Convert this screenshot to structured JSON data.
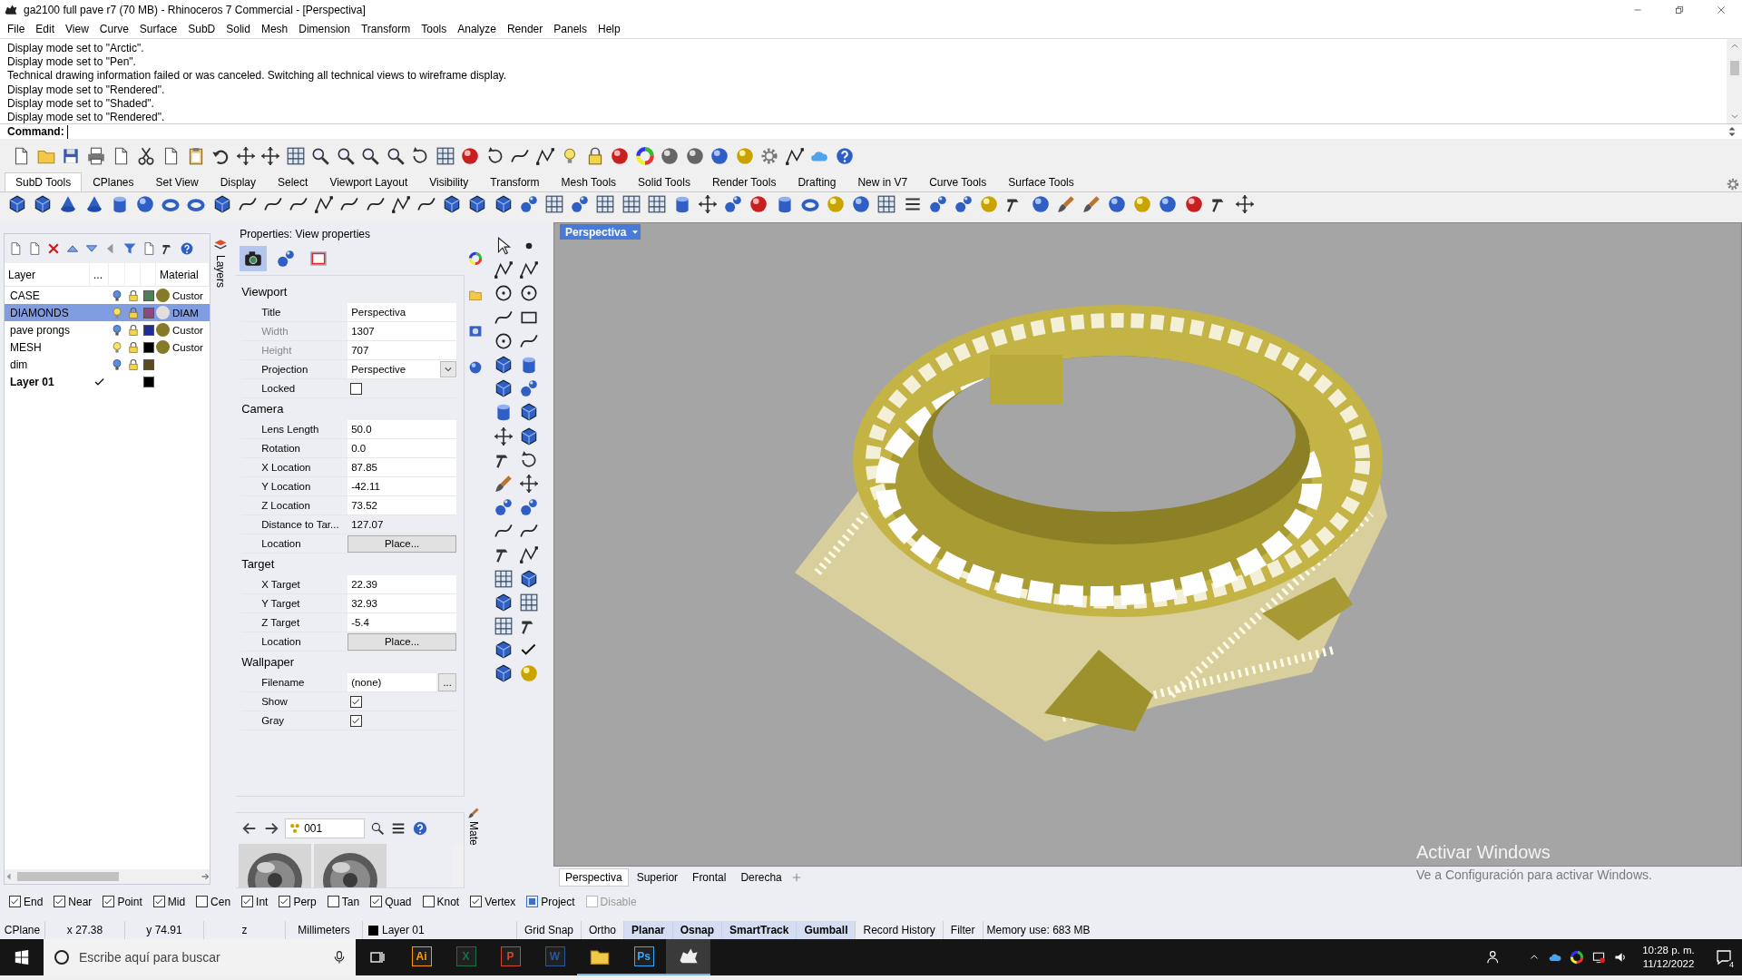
{
  "window": {
    "title": "ga2100 full pave r7 (70 MB) - Rhinoceros 7 Commercial - [Perspectiva]"
  },
  "menu": [
    "File",
    "Edit",
    "View",
    "Curve",
    "Surface",
    "SubD",
    "Solid",
    "Mesh",
    "Dimension",
    "Transform",
    "Tools",
    "Analyze",
    "Render",
    "Panels",
    "Help"
  ],
  "command_history": [
    "Display mode set to \"Arctic\".",
    "Display mode set to \"Pen\".",
    "Technical drawing information failed or was canceled. Switching all technical views to wireframe display.",
    "Display mode set to \"Rendered\".",
    "Display mode set to \"Shaded\".",
    "Display mode set to \"Rendered\"."
  ],
  "command": {
    "label": "Command:"
  },
  "toolbar_tabs": [
    {
      "label": "SubD Tools",
      "selected": true
    },
    {
      "label": "CPlanes",
      "selected": false
    },
    {
      "label": "Set View",
      "selected": false
    },
    {
      "label": "Display",
      "selected": false
    },
    {
      "label": "Select",
      "selected": false
    },
    {
      "label": "Viewport Layout",
      "selected": false
    },
    {
      "label": "Visibility",
      "selected": false
    },
    {
      "label": "Transform",
      "selected": false
    },
    {
      "label": "Mesh Tools",
      "selected": false
    },
    {
      "label": "Solid Tools",
      "selected": false
    },
    {
      "label": "Render Tools",
      "selected": false
    },
    {
      "label": "Drafting",
      "selected": false
    },
    {
      "label": "New in V7",
      "selected": false
    },
    {
      "label": "Curve Tools",
      "selected": false
    },
    {
      "label": "Surface Tools",
      "selected": false
    }
  ],
  "layers": {
    "tab_label": "Layers",
    "columns": [
      "Layer",
      "...",
      "Material"
    ],
    "rows": [
      {
        "name": "CASE",
        "selected": false,
        "current": false,
        "bulb_lit": false,
        "color": "#4f7f57",
        "material": {
          "name": "Custor",
          "color": "#857a28"
        }
      },
      {
        "name": "DIAMONDS",
        "selected": true,
        "current": false,
        "bulb_lit": true,
        "color": "#8a4a80",
        "material": {
          "name": "DIAM",
          "color": "#e2dede"
        }
      },
      {
        "name": "pave prongs",
        "selected": false,
        "current": false,
        "bulb_lit": false,
        "color": "#1c2a9a",
        "material": {
          "name": "Custor",
          "color": "#857a28"
        }
      },
      {
        "name": "MESH",
        "selected": false,
        "current": false,
        "bulb_lit": true,
        "color": "#000000",
        "material": {
          "name": "Custor",
          "color": "#857a28"
        }
      },
      {
        "name": "dim",
        "selected": false,
        "current": false,
        "bulb_lit": false,
        "color": "#5a4a1e"
      },
      {
        "name": "Layer 01",
        "selected": false,
        "current": true,
        "color": "#000000"
      }
    ]
  },
  "properties": {
    "title": "Properties: View properties",
    "pages": [
      {
        "kind": "camera",
        "selected": true
      },
      {
        "kind": "spheres",
        "selected": false
      },
      {
        "kind": "frame",
        "selected": false
      }
    ],
    "sections": [
      {
        "title": "Viewport",
        "rows": [
          {
            "kind": "field",
            "label": "Title",
            "value": "Perspectiva",
            "disabled": false
          },
          {
            "kind": "field",
            "label": "Width",
            "value": "1307",
            "disabled": true
          },
          {
            "kind": "field",
            "label": "Height",
            "value": "707",
            "disabled": true
          },
          {
            "kind": "dropdown",
            "label": "Projection",
            "value": "Perspective",
            "disabled": false
          },
          {
            "kind": "checkbox",
            "label": "Locked",
            "checked": false,
            "disabled": false
          }
        ]
      },
      {
        "title": "Camera",
        "rows": [
          {
            "kind": "field",
            "label": "Lens Length",
            "value": "50.0",
            "disabled": false
          },
          {
            "kind": "field",
            "label": "Rotation",
            "value": "0.0",
            "disabled": false
          },
          {
            "kind": "field",
            "label": "X Location",
            "value": "87.85",
            "disabled": false
          },
          {
            "kind": "field",
            "label": "Y Location",
            "value": "-42.11",
            "disabled": false
          },
          {
            "kind": "field",
            "label": "Z Location",
            "value": "73.52",
            "disabled": false
          },
          {
            "kind": "value",
            "label": "Distance to Tar...",
            "value": "127.07",
            "disabled": false
          },
          {
            "kind": "button",
            "label": "Location",
            "value": "Place...",
            "disabled": false
          }
        ]
      },
      {
        "title": "Target",
        "rows": [
          {
            "kind": "field",
            "label": "X Target",
            "value": "22.39",
            "disabled": false
          },
          {
            "kind": "field",
            "label": "Y Target",
            "value": "32.93",
            "disabled": false
          },
          {
            "kind": "field",
            "label": "Z Target",
            "value": "-5.4",
            "disabled": false
          },
          {
            "kind": "button",
            "label": "Location",
            "value": "Place...",
            "disabled": false
          }
        ]
      },
      {
        "title": "Wallpaper",
        "rows": [
          {
            "kind": "browse",
            "label": "Filename",
            "value": "(none)",
            "button": "...",
            "disabled": false
          },
          {
            "kind": "checkbox",
            "label": "Show",
            "checked": true,
            "disabled": false
          },
          {
            "kind": "checkbox",
            "label": "Gray",
            "checked": true,
            "disabled": false
          }
        ]
      }
    ]
  },
  "materials": {
    "tab_label": "Mate",
    "search": "001"
  },
  "viewport": {
    "title": "Perspectiva",
    "tabs": [
      {
        "label": "Perspectiva",
        "selected": true
      },
      {
        "label": "Superior",
        "selected": false
      },
      {
        "label": "Frontal",
        "selected": false
      },
      {
        "label": "Derecha",
        "selected": false
      }
    ],
    "activation_notice": {
      "title": "Activar Windows",
      "text": "Ve a Configuración para activar Windows."
    }
  },
  "osnaps": [
    {
      "kind": "tick",
      "label": "End",
      "checked": true,
      "disabled": false
    },
    {
      "kind": "tick",
      "label": "Near",
      "checked": true,
      "disabled": false
    },
    {
      "kind": "tick",
      "label": "Point",
      "checked": true,
      "disabled": false
    },
    {
      "kind": "tick",
      "label": "Mid",
      "checked": true,
      "disabled": false
    },
    {
      "kind": "tick",
      "label": "Cen",
      "checked": false,
      "disabled": false
    },
    {
      "kind": "tick",
      "label": "Int",
      "checked": true,
      "disabled": false
    },
    {
      "kind": "tick",
      "label": "Perp",
      "checked": true,
      "disabled": false
    },
    {
      "kind": "tick",
      "label": "Tan",
      "checked": false,
      "disabled": false
    },
    {
      "kind": "tick",
      "label": "Quad",
      "checked": true,
      "disabled": false
    },
    {
      "kind": "tick",
      "label": "Knot",
      "checked": false,
      "disabled": false
    },
    {
      "kind": "tick",
      "label": "Vertex",
      "checked": true,
      "disabled": false
    },
    {
      "kind": "square",
      "label": "Project",
      "checked": true,
      "disabled": false
    },
    {
      "kind": "tick",
      "label": "Disable",
      "checked": false,
      "disabled": true
    }
  ],
  "status_bar": {
    "cells": [
      {
        "kind": "text",
        "label": "CPlane"
      },
      {
        "kind": "text",
        "label": "x 27.38"
      },
      {
        "kind": "text",
        "label": "y 74.91"
      },
      {
        "kind": "text",
        "label": "z"
      },
      {
        "kind": "text",
        "label": "Millimeters"
      },
      {
        "kind": "layer",
        "label": "Layer 01",
        "color": "#000000"
      }
    ],
    "toggles": [
      {
        "label": "Grid Snap",
        "on": false
      },
      {
        "label": "Ortho",
        "on": false
      },
      {
        "label": "Planar",
        "on": true
      },
      {
        "label": "Osnap",
        "on": true
      },
      {
        "label": "SmartTrack",
        "on": true
      },
      {
        "label": "Gumball",
        "on": true
      },
      {
        "label": "Record History",
        "on": false
      },
      {
        "label": "Filter",
        "on": false
      }
    ],
    "memory": "Memory use: 683 MB"
  },
  "taskbar": {
    "search_placeholder": "Escribe aquí para buscar",
    "apps": [
      {
        "kind": "tile",
        "label": "Ai",
        "color": "#ff9a00",
        "running": false,
        "active": false
      },
      {
        "kind": "tile",
        "label": "X",
        "color": "#1d7044",
        "running": false,
        "active": false
      },
      {
        "kind": "tile",
        "label": "P",
        "color": "#d24726",
        "running": false,
        "active": false
      },
      {
        "kind": "tile",
        "label": "W",
        "color": "#2b579a",
        "running": false,
        "active": false
      },
      {
        "kind": "folder",
        "running": true,
        "active": false
      },
      {
        "kind": "tile",
        "label": "Ps",
        "color": "#31a8ff",
        "running": true,
        "active": false
      },
      {
        "kind": "rhino",
        "running": true,
        "active": true
      }
    ],
    "time": "10:28 p. m.",
    "date": "11/12/2022",
    "notifications": "4"
  }
}
